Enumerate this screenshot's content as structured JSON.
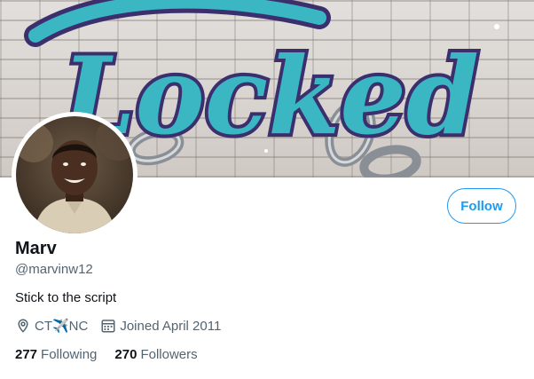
{
  "profile": {
    "banner_text": "Locked",
    "name": "Marv",
    "handle": "@marvinw12",
    "bio": "Stick to the script",
    "location": "CT✈️NC",
    "joined": "Joined April 2011",
    "follow_label": "Follow"
  },
  "stats": {
    "following_count": "277",
    "following_label": "Following",
    "followers_count": "270",
    "followers_label": "Followers"
  },
  "icons": {
    "location": "location-pin-icon",
    "calendar": "calendar-icon"
  },
  "colors": {
    "accent": "#1d9bf0",
    "secondary_text": "#536471",
    "banner_letter_fill": "#3bb7c4",
    "banner_letter_outline": "#3b2f6e"
  }
}
